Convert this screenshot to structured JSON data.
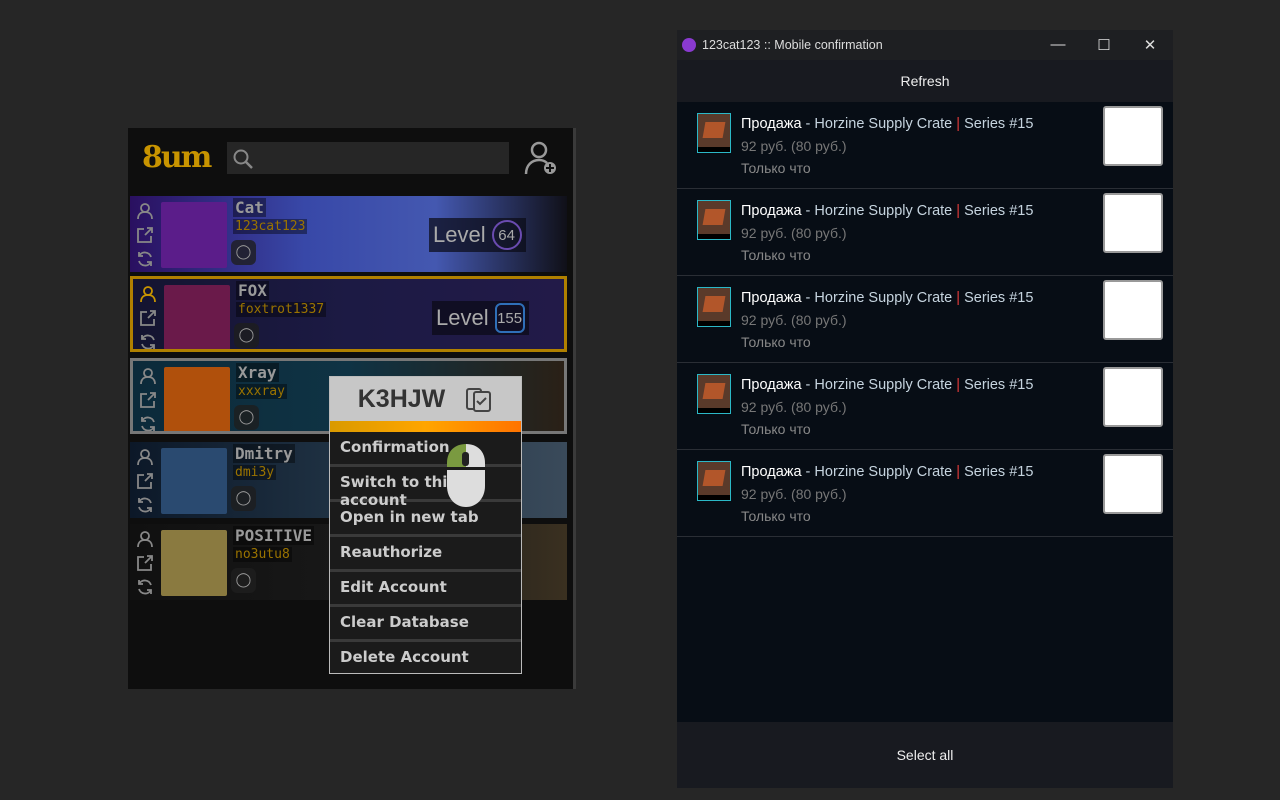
{
  "sam": {
    "logo": "8um",
    "search_placeholder": "",
    "accounts": [
      {
        "name": "Cat",
        "login": "123cat123",
        "level": "64",
        "bg": "linear-gradient(90deg,#2a1060,#3848a8 40%,#4458b0 70%,#101018)",
        "avatar": "#5b1d8a",
        "border": "none"
      },
      {
        "name": "FOX",
        "login": "foxtrot1337",
        "level": "155",
        "bg": "linear-gradient(90deg,#141430,#1c1a44 50%,#221a48)",
        "avatar": "#6a1a4a",
        "border": "3px solid #b08000"
      },
      {
        "name": "Xray",
        "login": "xxxray",
        "level": "",
        "bg": "linear-gradient(90deg,#0c2a3a,#0f3344 50%,#2a2016)",
        "avatar": "#b0500c",
        "border": "3px solid #777"
      },
      {
        "name": "Dmitry",
        "login": "dmi3y",
        "level": "",
        "bg": "linear-gradient(90deg,#0c1828,#24384a 60%,#3a4a5a)",
        "avatar": "#2a4a70",
        "border": "none"
      },
      {
        "name": "POSITIVE",
        "login": "no3utu8",
        "level": "",
        "bg": "linear-gradient(90deg,#101010,#1a1a1a 60%,#3a3020)",
        "avatar": "#8a7a40",
        "border": "none"
      }
    ],
    "level_label": "Level",
    "context_menu": {
      "code": "K3HJW",
      "items": [
        "Confirmation",
        "Switch to this account",
        "Open in new tab",
        "Reauthorize",
        "Edit Account",
        "Clear Database",
        "Delete Account"
      ]
    }
  },
  "confirm_window": {
    "title": "123cat123 :: Mobile confirmation",
    "refresh": "Refresh",
    "select_all": "Select all",
    "items": [
      {
        "type": "Продажа",
        "sep1": " - ",
        "item": "Horzine Supply Crate",
        "sep": " | ",
        "series": "Series #15",
        "price": "92 руб. (80 руб.)",
        "time": "Только что"
      },
      {
        "type": "Продажа",
        "sep1": " - ",
        "item": "Horzine Supply Crate",
        "sep": " | ",
        "series": "Series #15",
        "price": "92 руб. (80 руб.)",
        "time": "Только что"
      },
      {
        "type": "Продажа",
        "sep1": " - ",
        "item": "Horzine Supply Crate",
        "sep": " | ",
        "series": "Series #15",
        "price": "92 руб. (80 руб.)",
        "time": "Только что"
      },
      {
        "type": "Продажа",
        "sep1": " - ",
        "item": "Horzine Supply Crate",
        "sep": " | ",
        "series": "Series #15",
        "price": "92 руб. (80 руб.)",
        "time": "Только что"
      },
      {
        "type": "Продажа",
        "sep1": " - ",
        "item": "Horzine Supply Crate",
        "sep": " | ",
        "series": "Series #15",
        "price": "92 руб. (80 руб.)",
        "time": "Только что"
      }
    ]
  },
  "colors": {
    "accent": "#c89400",
    "menu_bar": "#ffa500"
  }
}
